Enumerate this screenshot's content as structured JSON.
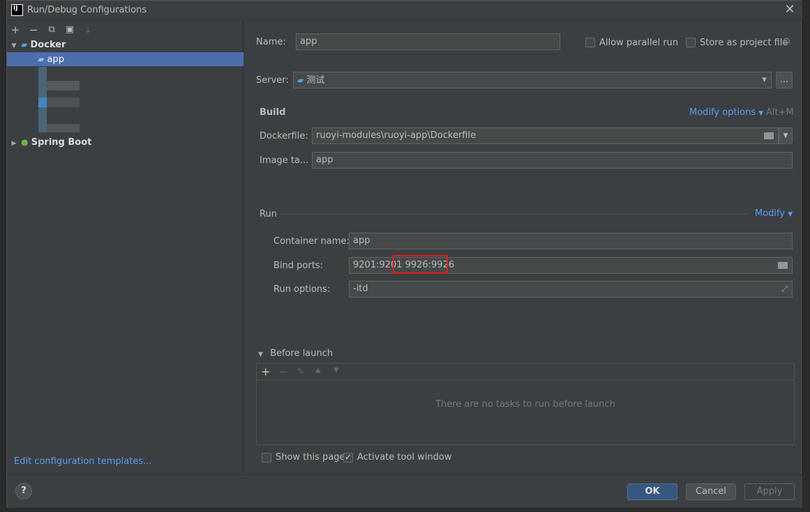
{
  "window": {
    "title": "Run/Debug Configurations",
    "logo": "IJ"
  },
  "left_toolbar": [
    "+",
    "−",
    "⧉",
    "▣",
    "↓"
  ],
  "tree": {
    "docker": {
      "label": "Docker"
    },
    "app": {
      "label": "app"
    },
    "spring_boot": {
      "label": "Spring Boot"
    }
  },
  "edit_templates": "Edit configuration templates...",
  "form": {
    "name_label": "Name:",
    "name_value": "app",
    "allow_parallel": "Allow parallel run",
    "store_project": "Store as project file",
    "server_label": "Server:",
    "server_value": "测试",
    "ellipsis": "...",
    "build_title": "Build",
    "modify_options": "Modify options",
    "shortcut": "Alt+M",
    "dockerfile_label": "Dockerfile:",
    "dockerfile_value": "ruoyi-modules\\ruoyi-app\\Dockerfile",
    "image_tag_label": "Image ta...",
    "image_tag_value": "app",
    "run_title": "Run",
    "modify": "Modify",
    "container_label": "Container name:",
    "container_value": "app",
    "bind_label": "Bind ports:",
    "bind_value_a": "9201:9201",
    "bind_value_b": "9926:9926",
    "run_options_label": "Run options:",
    "run_options_value": "-itd",
    "before_launch": "Before launch",
    "no_tasks": "There are no tasks to run before launch",
    "show_page": "Show this page",
    "activate_tool": "Activate tool window"
  },
  "buttons": {
    "ok": "OK",
    "cancel": "Cancel",
    "apply": "Apply",
    "help": "?"
  },
  "colors": {
    "accent": "#589df6",
    "selection": "#4b6eaf",
    "highlight": "#e02020",
    "primary_button": "#365880"
  }
}
